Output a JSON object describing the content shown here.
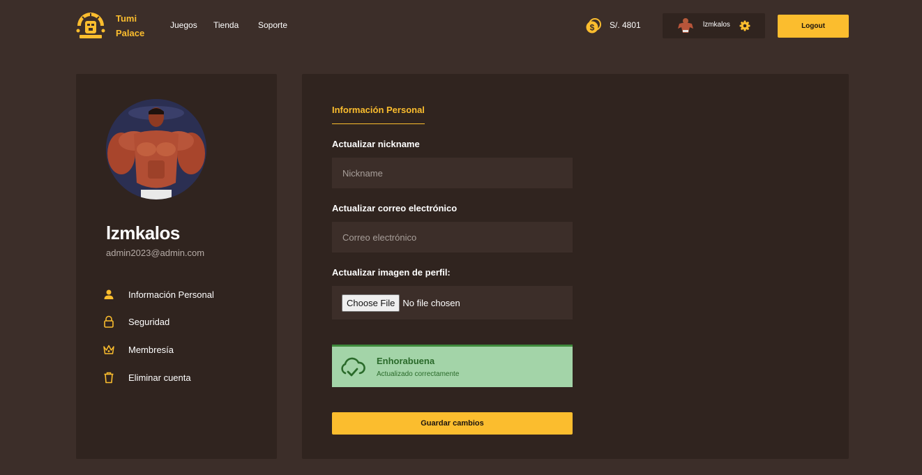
{
  "header": {
    "brand_line1": "Tumi",
    "brand_line2": "Palace",
    "nav": [
      "Juegos",
      "Tienda",
      "Soporte"
    ],
    "balance": "S/. 4801",
    "username": "lzmkalos",
    "logout_label": "Logout",
    "icons": {
      "logo": "sun-mask-logo-icon",
      "coin": "coin-icon",
      "settings": "gear-icon"
    }
  },
  "profile": {
    "name": "lzmkalos",
    "email": "admin2023@admin.com",
    "menu": [
      {
        "label": "Información Personal",
        "icon": "user-icon"
      },
      {
        "label": "Seguridad",
        "icon": "lock-icon"
      },
      {
        "label": "Membresía",
        "icon": "crown-icon"
      },
      {
        "label": "Eliminar cuenta",
        "icon": "trash-icon"
      }
    ]
  },
  "form": {
    "tab": "Información Personal",
    "nickname_label": "Actualizar nickname",
    "nickname_placeholder": "Nickname",
    "nickname_value": "",
    "email_label": "Actualizar correo electrónico",
    "email_placeholder": "Correo electrónico",
    "email_value": "",
    "image_label": "Actualizar imagen de perfil:",
    "choose_file": "Choose File",
    "no_file": "No file chosen",
    "alert_title": "Enhorabuena",
    "alert_message": "Actualizado correctamente",
    "save_label": "Guardar cambios"
  },
  "colors": {
    "background": "#3c2e29",
    "card": "#30241f",
    "accent": "#fbbd2e",
    "success_bg": "#a3d4a8",
    "success_text": "#2a6a2a"
  }
}
